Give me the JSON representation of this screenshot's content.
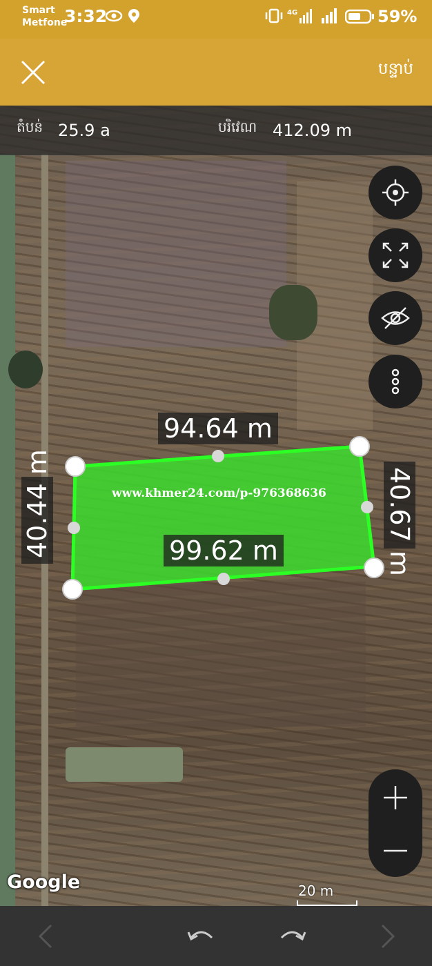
{
  "status": {
    "carrier_line1": "Smart",
    "carrier_line2": "Metfone",
    "time": "3:32",
    "battery": "59%",
    "network": "4G"
  },
  "toolbar": {
    "close_icon": "close-icon",
    "next_label": "បន្ទាប់"
  },
  "measurements": {
    "area_label": "តំបន់",
    "area_value": "25.9 a",
    "perimeter_label": "បរិវេណ",
    "perimeter_value": "412.09 m"
  },
  "polygon": {
    "fill_color": "#3ddc2e",
    "stroke_color": "#2bff24",
    "edges": {
      "top": "94.64 m",
      "right": "40.67 m",
      "bottom": "99.62 m",
      "left": "40.44 m"
    }
  },
  "watermark": "www.khmer24.com/p-976368636",
  "map_controls": [
    "my-location-icon",
    "fullscreen-icon",
    "hide-icon",
    "more-icon"
  ],
  "zoom": {
    "in": "+",
    "out": "−"
  },
  "attribution": "Google",
  "scale": "20 m",
  "nav": [
    "back-arrow-icon",
    "undo-icon",
    "redo-icon",
    "forward-arrow-icon"
  ]
}
